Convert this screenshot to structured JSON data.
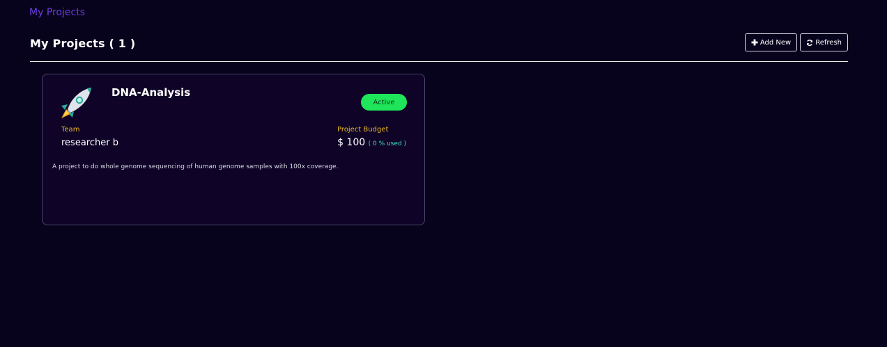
{
  "breadcrumb": {
    "label": "My Projects"
  },
  "header": {
    "title": "My Projects ( 1 )"
  },
  "toolbar": {
    "add_label": "Add New",
    "refresh_label": "Refresh"
  },
  "projects": [
    {
      "name": "DNA-Analysis",
      "status": "Active",
      "team_label": "Team",
      "team": "researcher b",
      "budget_label": "Project Budget",
      "budget": "$ 100",
      "budget_used": "( 0 % used )",
      "description": "A project to do whole genome sequencing of human genome samples with 100x coverage.",
      "icon": "rocket-icon"
    }
  ],
  "colors": {
    "background": "#07031d",
    "card_background": "#0f0427",
    "breadcrumb": "#6c3ce0",
    "label": "#e8b923",
    "status_active": "#1ee55a",
    "budget_used": "#3fe0c0"
  }
}
